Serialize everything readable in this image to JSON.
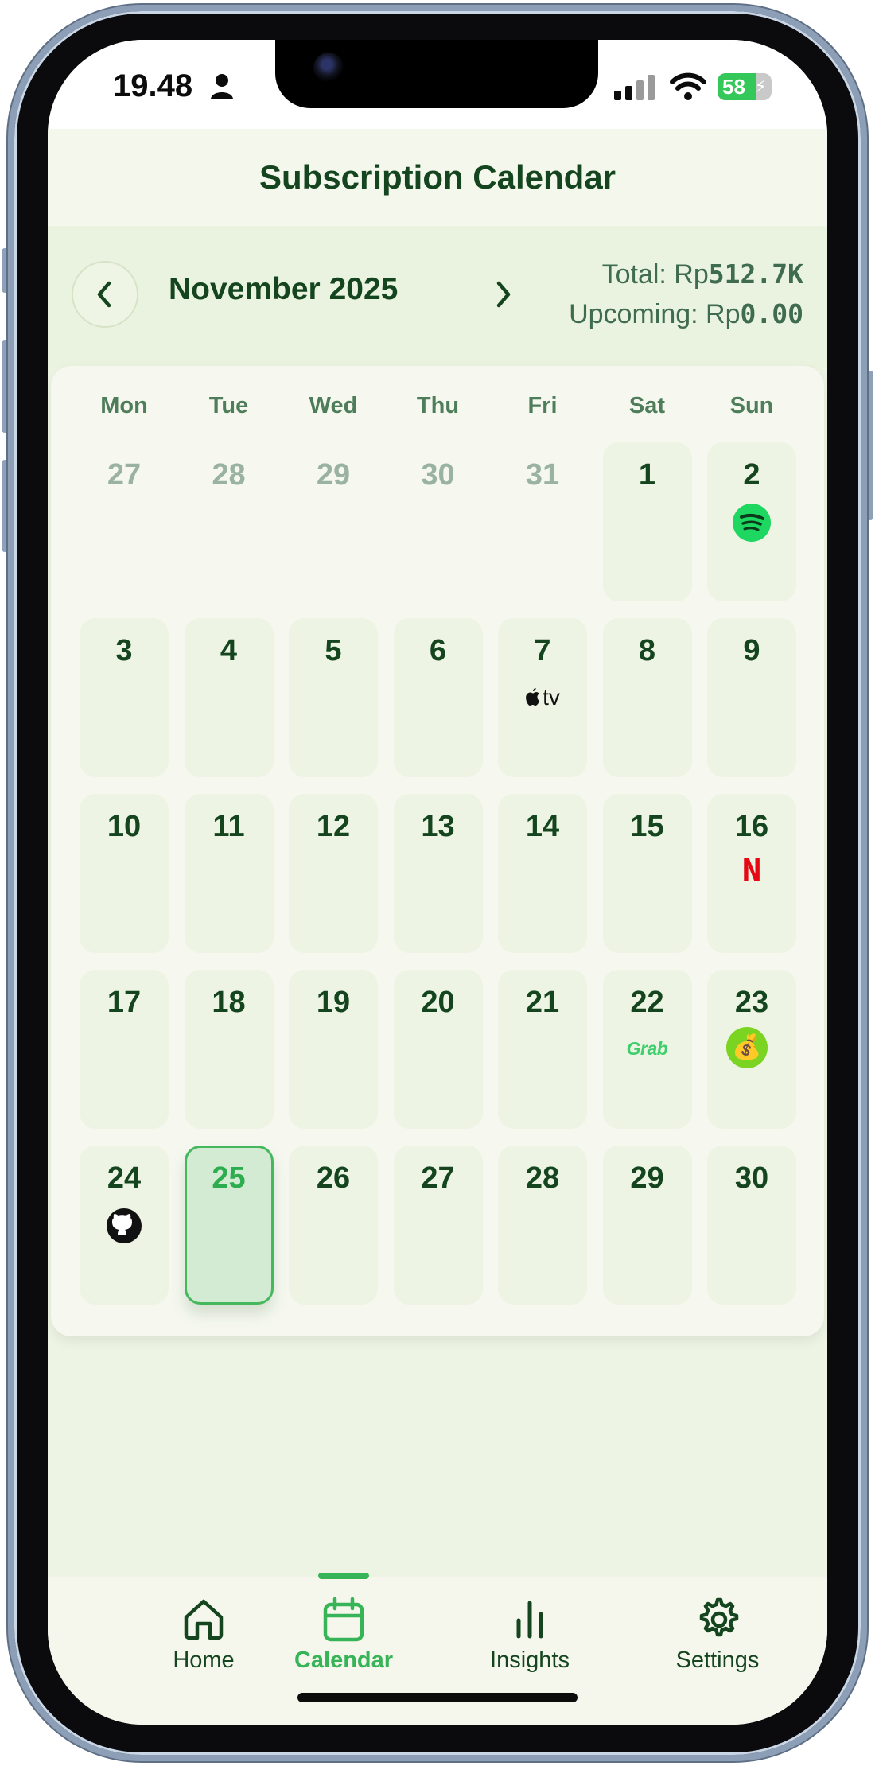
{
  "status_bar": {
    "time": "19.48",
    "battery": "58"
  },
  "header": {
    "title": "Subscription Calendar"
  },
  "month_bar": {
    "month": "November 2025",
    "total_label": "Total: Rp",
    "total_value": "512.7K",
    "upcoming_label": "Upcoming: Rp",
    "upcoming_value": "0.00"
  },
  "calendar": {
    "weekdays": [
      "Mon",
      "Tue",
      "Wed",
      "Thu",
      "Fri",
      "Sat",
      "Sun"
    ],
    "days": [
      {
        "num": "27",
        "outside": true
      },
      {
        "num": "28",
        "outside": true
      },
      {
        "num": "29",
        "outside": true
      },
      {
        "num": "30",
        "outside": true
      },
      {
        "num": "31",
        "outside": true
      },
      {
        "num": "1"
      },
      {
        "num": "2",
        "icon": "spotify-icon"
      },
      {
        "num": "3"
      },
      {
        "num": "4"
      },
      {
        "num": "5"
      },
      {
        "num": "6"
      },
      {
        "num": "7",
        "icon": "apple-tv-icon",
        "icon_text": "tv"
      },
      {
        "num": "8"
      },
      {
        "num": "9"
      },
      {
        "num": "10"
      },
      {
        "num": "11"
      },
      {
        "num": "12"
      },
      {
        "num": "13"
      },
      {
        "num": "14"
      },
      {
        "num": "15"
      },
      {
        "num": "16",
        "icon": "netflix-icon",
        "icon_text": "N"
      },
      {
        "num": "17"
      },
      {
        "num": "18"
      },
      {
        "num": "19"
      },
      {
        "num": "20"
      },
      {
        "num": "21"
      },
      {
        "num": "22",
        "icon": "grab-icon",
        "icon_text": "Grab"
      },
      {
        "num": "23",
        "icon": "money-bag-icon",
        "icon_text": "💰"
      },
      {
        "num": "24",
        "icon": "github-icon"
      },
      {
        "num": "25",
        "today": true
      },
      {
        "num": "26"
      },
      {
        "num": "27"
      },
      {
        "num": "28"
      },
      {
        "num": "29"
      },
      {
        "num": "30"
      }
    ]
  },
  "nav": {
    "home": "Home",
    "calendar": "Calendar",
    "insights": "Insights",
    "settings": "Settings"
  },
  "colors": {
    "primary_dark": "#14451f",
    "accent_green": "#37b457",
    "day_cell": "#edf4e3",
    "today_cell": "#d4ebd3",
    "netflix_red": "#e50914",
    "spotify_green": "#1ed760",
    "grab_green": "#3ccf6c"
  }
}
